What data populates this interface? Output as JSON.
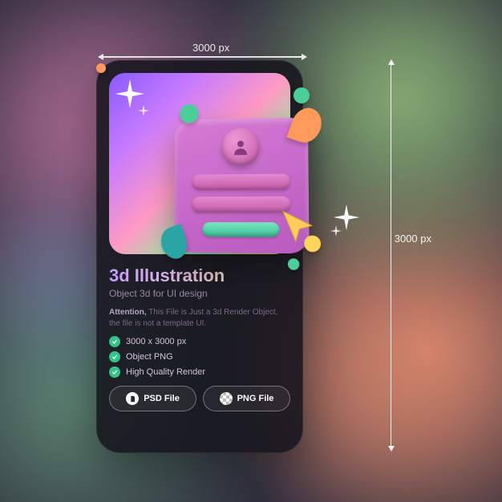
{
  "dimensions": {
    "width_label": "3000 px",
    "height_label": "3000 px"
  },
  "card": {
    "title": "3d Illustration",
    "subtitle": "Object 3d for UI design",
    "attention_label": "Attention,",
    "attention_text": " This File is Just a 3d Render Object, the file is not a template UI.",
    "features": [
      "3000 x 3000 px",
      "Object PNG",
      "High Quality Render"
    ],
    "buttons": {
      "psd": "PSD File",
      "png": "PNG File"
    }
  },
  "illustration": {
    "type": "login-form-3d",
    "avatar_icon": "user-icon",
    "cursor_icon": "arrow-cursor-icon"
  },
  "colors": {
    "accent_purple": "#c39aff",
    "accent_green": "#34c48a",
    "accent_orange": "#ff9a5a"
  }
}
